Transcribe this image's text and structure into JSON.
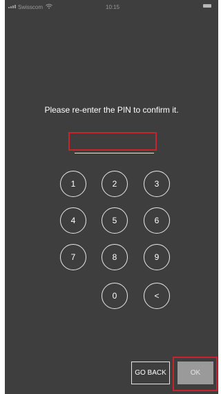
{
  "status_bar": {
    "carrier": "Swisscom",
    "time": "10:15"
  },
  "prompt": "Please re-enter the PIN to confirm it.",
  "pin_input": {
    "value": ""
  },
  "keypad": {
    "k1": "1",
    "k2": "2",
    "k3": "3",
    "k4": "4",
    "k5": "5",
    "k6": "6",
    "k7": "7",
    "k8": "8",
    "k9": "9",
    "k0": "0",
    "back": "<"
  },
  "buttons": {
    "go_back": "GO BACK",
    "ok": "OK"
  },
  "colors": {
    "background": "#3e3e3e",
    "highlight": "#c8242c",
    "ok_button": "#9a9a9a"
  }
}
